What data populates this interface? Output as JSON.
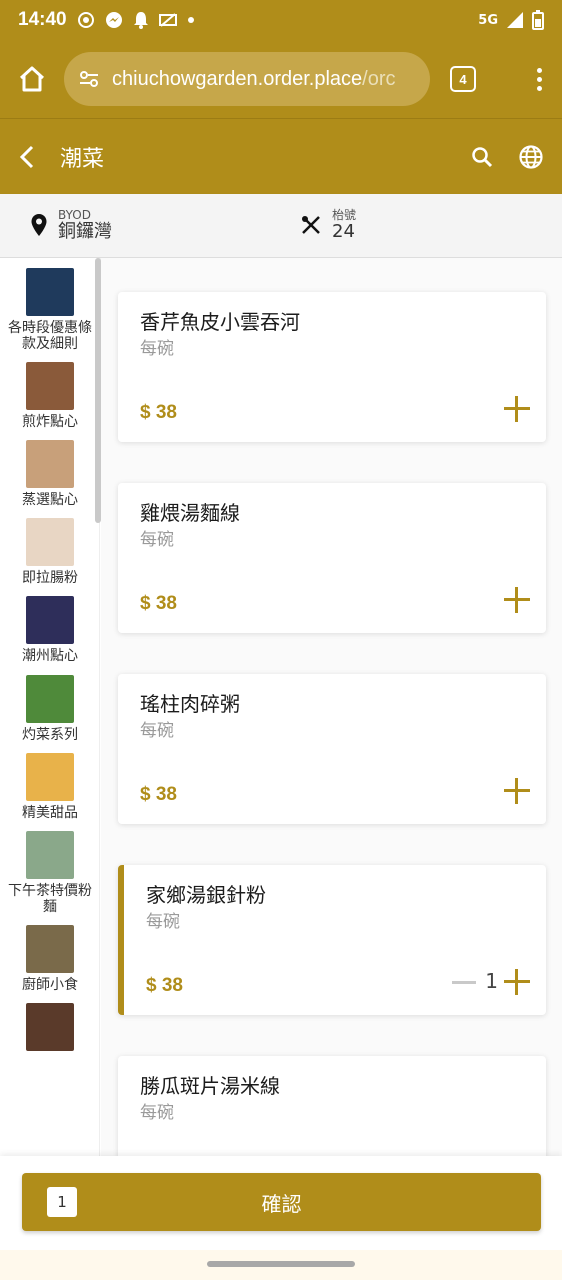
{
  "status": {
    "time": "14:40",
    "network": "5G"
  },
  "browser": {
    "url_main": "chiuchowgarden.order.place",
    "url_rest": "/orc",
    "tab_count": "4"
  },
  "header": {
    "title": "潮菜"
  },
  "info": {
    "location_label": "BYOD",
    "location_value": "銅鑼灣",
    "table_label": "枱號",
    "table_value": "24"
  },
  "categories": [
    {
      "label": "各時段優惠條款及細則",
      "thumb_color": "#1f3a5c"
    },
    {
      "label": "煎炸點心",
      "thumb_color": "#8a5a3a"
    },
    {
      "label": "蒸選點心",
      "thumb_color": "#c8a07a"
    },
    {
      "label": "即拉腸粉",
      "thumb_color": "#e8d6c4"
    },
    {
      "label": "潮州點心",
      "thumb_color": "#2e2e5a"
    },
    {
      "label": "灼菜系列",
      "thumb_color": "#4f8a3a"
    },
    {
      "label": "精美甜品",
      "thumb_color": "#e8b24a"
    },
    {
      "label": "下午茶特價粉麵",
      "thumb_color": "#8aa88a"
    },
    {
      "label": "廚師小食",
      "thumb_color": "#7a6a4a"
    },
    {
      "label": "",
      "thumb_color": "#5a3a2a"
    }
  ],
  "menu_items": [
    {
      "name": "香芹魚皮小雲吞河",
      "unit": "每碗",
      "price": "$ 38",
      "qty": ""
    },
    {
      "name": "雞煨湯麵線",
      "unit": "每碗",
      "price": "$ 38",
      "qty": ""
    },
    {
      "name": "瑤柱肉碎粥",
      "unit": "每碗",
      "price": "$ 38",
      "qty": ""
    },
    {
      "name": "家鄉湯銀針粉",
      "unit": "每碗",
      "price": "$ 38",
      "qty": "1"
    },
    {
      "name": "勝瓜斑片湯米線",
      "unit": "每碗",
      "price": "",
      "qty": ""
    }
  ],
  "footer": {
    "cart_count": "1",
    "confirm_label": "確認"
  },
  "colors": {
    "brand": "#b08d1a"
  }
}
